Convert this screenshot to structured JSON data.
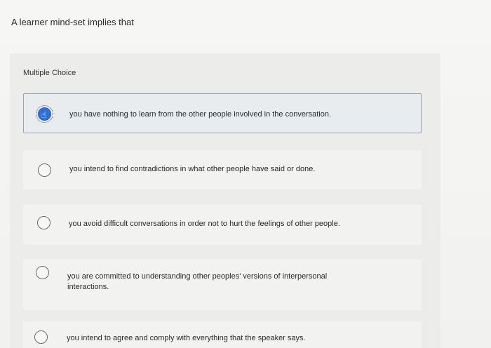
{
  "question": {
    "text": "A learner mind-set implies that"
  },
  "section": {
    "label": "Multiple Choice"
  },
  "options": [
    {
      "text": "you have nothing to learn from the other people involved in the conversation.",
      "selected": true
    },
    {
      "text": "you intend to find contradictions in what other people have said or done.",
      "selected": false
    },
    {
      "text": "you avoid difficult conversations in order not to hurt the feelings of other people.",
      "selected": false
    },
    {
      "text": "you are committed to understanding other peoples' versions of interpersonal interactions.",
      "selected": false
    },
    {
      "text": "you intend to agree and comply with everything that the speaker says.",
      "selected": false
    }
  ],
  "colors": {
    "selected_radio": "#2f6fd6",
    "selected_border": "#9aa3ad"
  }
}
